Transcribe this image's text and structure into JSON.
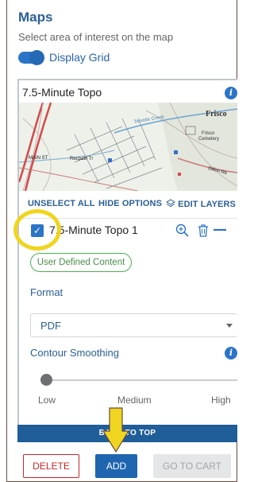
{
  "header": {
    "title": "Maps",
    "subtitle": "Select area of interest on the map",
    "toggle_label": "Display Grid",
    "toggle_on": true
  },
  "product": {
    "title": "7.5-Minute Topo",
    "map_labels": {
      "place1": "Frisco",
      "place2": "Frisco",
      "place3": "Cemetery",
      "creek": "Tenmile Creek",
      "street1": "MAIN ST",
      "street2": "Recpath Tr",
      "street3": "Dillon Re"
    },
    "unselect_all": "UNSELECT ALL",
    "hide_options": "HIDE OPTIONS",
    "edit_layers": "EDIT LAYERS",
    "item_label": "7.5-Minute Topo 1",
    "item_checked": true,
    "badge": "User Defined Content",
    "format_label": "Format",
    "format_value": "PDF",
    "contour_label": "Contour Smoothing",
    "slider_low": "Low",
    "slider_medium": "Medium",
    "slider_high": "High",
    "slider_value": 0
  },
  "back_to_top": "BACK TO TOP",
  "buttons": {
    "delete": "DELETE",
    "add": "ADD",
    "go_to_cart": "GO TO CART"
  },
  "colors": {
    "primary": "#1f65b0",
    "title": "#2a5f95",
    "danger": "#c62828",
    "success": "#4caf50",
    "highlight": "#efd51f"
  }
}
